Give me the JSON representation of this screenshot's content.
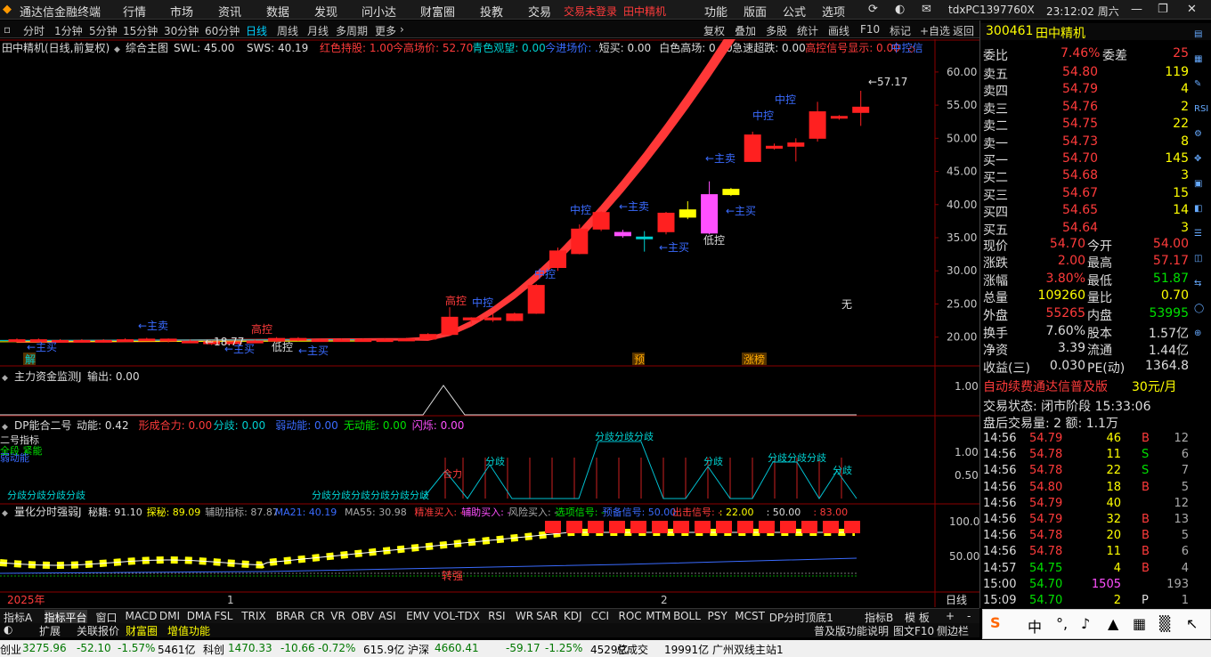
{
  "window": {
    "app_title": "通达信金融终端",
    "menu": [
      "行情",
      "市场",
      "资讯",
      "数据",
      "发现",
      "问小达",
      "财富圈",
      "投教",
      "交易"
    ],
    "trade_status": "交易未登录",
    "stock_name_top": "田中精机",
    "menu_right": [
      "功能",
      "版面",
      "公式",
      "选项"
    ],
    "host": "tdxPC1397760X",
    "clock": "23:12:02 周六"
  },
  "period_bar": {
    "items": [
      "分时",
      "1分钟",
      "5分钟",
      "15分钟",
      "30分钟",
      "60分钟",
      "日线",
      "周线",
      "月线",
      "多周期",
      "更多"
    ],
    "active": "日线",
    "right_buttons": [
      "复权",
      "叠加",
      "多股",
      "统计",
      "画线",
      "F10",
      "标记",
      "+自选",
      "返回"
    ]
  },
  "main_chart": {
    "header_prefix": "田中精机(日线,前复权)",
    "indicator_name": "综合主图",
    "indicators": [
      {
        "text": "SWL: 45.00",
        "color": "#dddddd"
      },
      {
        "text": "SWS: 40.19",
        "color": "#dddddd"
      },
      {
        "text": "红色持股: 1.00",
        "color": "#ff3b3b"
      },
      {
        "text": "今高场价: 52.70",
        "color": "#ff3b3b"
      },
      {
        "text": "青色观望: 0.00",
        "color": "#00d0d0"
      },
      {
        "text": "今进场价: .",
        "color": "#3a6bff"
      },
      {
        "text": "短买: 0.00",
        "color": "#dddddd"
      },
      {
        "text": "白色高场: 0.00",
        "color": "#dddddd"
      },
      {
        "text": "急速超跌: 0.00",
        "color": "#dddddd"
      },
      {
        "text": "高控信号显示: 0.00",
        "color": "#ff3b3b"
      },
      {
        "text": "中控信",
        "color": "#3a6bff"
      }
    ],
    "y_ticks": [
      "60.00",
      "55.00",
      "50.00",
      "45.00",
      "40.00",
      "35.00",
      "30.00",
      "25.00",
      "20.00"
    ],
    "price_high_label": "57.17",
    "price_low_label": "18.77",
    "none_label": "无",
    "bottom_tags": [
      "解",
      "预",
      "涨榜"
    ],
    "annotations": [
      "←主买",
      "←主卖",
      "高控",
      "低控",
      "中控",
      "←主卖",
      "←主买",
      "低控"
    ]
  },
  "chart_data": {
    "type": "candlestick",
    "ylim": [
      17,
      62
    ],
    "candles": [
      {
        "o": 19.6,
        "c": 19.5,
        "h": 19.8,
        "l": 19.3
      },
      {
        "o": 19.5,
        "c": 19.6,
        "h": 19.8,
        "l": 19.3
      },
      {
        "o": 19.5,
        "c": 19.4,
        "h": 19.7,
        "l": 19.2
      },
      {
        "o": 19.4,
        "c": 19.5,
        "h": 19.7,
        "l": 19.2
      },
      {
        "o": 19.5,
        "c": 19.4,
        "h": 19.7,
        "l": 19.2
      },
      {
        "o": 19.4,
        "c": 19.6,
        "h": 19.8,
        "l": 19.3
      },
      {
        "o": 19.6,
        "c": 19.7,
        "h": 19.9,
        "l": 19.4
      },
      {
        "o": 19.7,
        "c": 19.4,
        "h": 19.8,
        "l": 19.2
      },
      {
        "o": 19.4,
        "c": 19.3,
        "h": 19.6,
        "l": 19.1
      },
      {
        "o": 19.3,
        "c": 19.0,
        "h": 19.5,
        "l": 18.8
      },
      {
        "o": 19.0,
        "c": 19.3,
        "h": 19.4,
        "l": 18.77
      },
      {
        "o": 19.3,
        "c": 19.4,
        "h": 19.6,
        "l": 19.1
      },
      {
        "o": 19.4,
        "c": 19.8,
        "h": 20.0,
        "l": 19.2
      },
      {
        "o": 19.8,
        "c": 19.6,
        "h": 20.0,
        "l": 19.4
      },
      {
        "o": 19.6,
        "c": 19.5,
        "h": 19.8,
        "l": 19.3
      },
      {
        "o": 19.5,
        "c": 19.6,
        "h": 19.8,
        "l": 19.3
      },
      {
        "o": 19.6,
        "c": 19.5,
        "h": 19.8,
        "l": 19.3
      },
      {
        "o": 19.5,
        "c": 19.6,
        "h": 19.8,
        "l": 19.3
      },
      {
        "o": 19.6,
        "c": 19.7,
        "h": 19.9,
        "l": 19.4
      },
      {
        "o": 19.7,
        "c": 20.4,
        "h": 20.6,
        "l": 19.6
      },
      {
        "o": 20.4,
        "c": 23.0,
        "h": 24.5,
        "l": 20.3
      },
      {
        "o": 22.9,
        "c": 22.6,
        "h": 23.0,
        "l": 22.0
      },
      {
        "o": 22.6,
        "c": 22.9,
        "h": 23.5,
        "l": 22.3
      },
      {
        "o": 22.5,
        "c": 23.5,
        "h": 23.7,
        "l": 22.4
      },
      {
        "o": 23.6,
        "c": 27.8,
        "h": 28.0,
        "l": 23.5
      },
      {
        "o": 30.5,
        "c": 33.0,
        "h": 33.5,
        "l": 30.0
      },
      {
        "o": 32.6,
        "c": 36.3,
        "h": 37.0,
        "l": 32.5
      },
      {
        "o": 36.3,
        "c": 38.8,
        "h": 39.0,
        "l": 36.0
      },
      {
        "o": 35.8,
        "c": 35.3,
        "h": 36.2,
        "l": 35.0
      },
      {
        "o": 35.1,
        "c": 35.0,
        "h": 36.0,
        "l": 32.9
      },
      {
        "o": 35.9,
        "c": 38.7,
        "h": 38.9,
        "l": 35.5
      },
      {
        "o": 38.1,
        "c": 39.2,
        "h": 40.5,
        "l": 37.8
      },
      {
        "o": 35.7,
        "c": 41.5,
        "h": 43.5,
        "l": 35.5
      },
      {
        "o": 41.5,
        "c": 42.3,
        "h": 42.5,
        "l": 41.3
      },
      {
        "o": 46.5,
        "c": 50.5,
        "h": 51.0,
        "l": 46.5
      },
      {
        "o": 48.5,
        "c": 48.8,
        "h": 49.2,
        "l": 48.3
      },
      {
        "o": 48.8,
        "c": 49.3,
        "h": 50.0,
        "l": 46.5
      },
      {
        "o": 50.0,
        "c": 54.0,
        "h": 55.5,
        "l": 49.5
      },
      {
        "o": 53.1,
        "c": 53.3,
        "h": 53.5,
        "l": 52.8
      },
      {
        "o": 53.9,
        "c": 54.7,
        "h": 57.17,
        "l": 51.87
      }
    ]
  },
  "ind1": {
    "name": "主力资金监测J",
    "output": "输出: 0.00",
    "ticks": [
      "1.00"
    ]
  },
  "ind2": {
    "name": "DP能合二号",
    "items": [
      {
        "text": "动能: 0.42",
        "color": "#dddddd"
      },
      {
        "text": "形成合力: 0.00",
        "color": "#ff3b3b"
      },
      {
        "text": "分歧: 0.00",
        "color": "#00d0d0"
      },
      {
        "text": "弱动能: 0.00",
        "color": "#3a6bff"
      },
      {
        "text": "无动能: 0.00",
        "color": "#00e000"
      },
      {
        "text": "闪烁: 0.00",
        "color": "#ff50ff"
      }
    ],
    "ticks": [
      "1.00",
      "0.50"
    ],
    "left_labels": [
      "二号指标",
      "全段 紧能",
      "弱动能",
      "无动能"
    ],
    "peak_labels": [
      "分歧",
      "分歧",
      "分歧",
      "分歧",
      "分歧",
      "分歧",
      "合力",
      "分歧分歧分歧"
    ]
  },
  "ind3": {
    "name": "量化分时强弱J",
    "items": [
      {
        "text": "秘籍: 91.10",
        "color": "#dddddd"
      },
      {
        "text": "探秘: 89.09",
        "color": "#ffff00"
      },
      {
        "text": "辅助指标: 87.87",
        "color": "#aaaaaa"
      },
      {
        "text": "MA21: 40.19",
        "color": "#3a6bff"
      },
      {
        "text": "MA55: 30.98",
        "color": "#aaaaaa"
      },
      {
        "text": "精准买入: -",
        "color": "#ff3b3b"
      },
      {
        "text": "辅助买入: -",
        "color": "#ff50ff"
      },
      {
        "text": "风险买入: -",
        "color": "#aaaaaa"
      },
      {
        "text": "选项信号: -",
        "color": "#00e000"
      },
      {
        "text": "预备信号: 50.00",
        "color": "#3a6bff"
      },
      {
        "text": "出击信号: -",
        "color": "#ff3b3b"
      },
      {
        "text": ": 22.00",
        "color": "#ffff00"
      },
      {
        "text": ": 50.00",
        "color": "#dddddd"
      },
      {
        "text": ": 83.00",
        "color": "#ff3b3b"
      }
    ],
    "ticks": [
      "100.0",
      "50.00"
    ],
    "label_mid": "转强"
  },
  "x_axis": {
    "labels": [
      "2025年",
      "1",
      "2"
    ],
    "period": "日线"
  },
  "quote": {
    "code": "300461",
    "name": "田中精机",
    "weibi_label": "委比",
    "weibi": "7.46%",
    "weicha_label": "委差",
    "weicha": "25",
    "asks": [
      {
        "label": "卖五",
        "price": "54.80",
        "vol": "119"
      },
      {
        "label": "卖四",
        "price": "54.79",
        "vol": "4"
      },
      {
        "label": "卖三",
        "price": "54.76",
        "vol": "2"
      },
      {
        "label": "卖二",
        "price": "54.75",
        "vol": "22"
      },
      {
        "label": "卖一",
        "price": "54.73",
        "vol": "8"
      }
    ],
    "bids": [
      {
        "label": "买一",
        "price": "54.70",
        "vol": "145"
      },
      {
        "label": "买二",
        "price": "54.68",
        "vol": "3"
      },
      {
        "label": "买三",
        "price": "54.67",
        "vol": "15"
      },
      {
        "label": "买四",
        "price": "54.65",
        "vol": "14"
      },
      {
        "label": "买五",
        "price": "54.64",
        "vol": "3"
      }
    ],
    "stats": [
      {
        "l1": "现价",
        "v1": "54.70",
        "c1": "#ff3b3b",
        "l2": "今开",
        "v2": "54.00",
        "c2": "#ff3b3b"
      },
      {
        "l1": "涨跌",
        "v1": "2.00",
        "c1": "#ff3b3b",
        "l2": "最高",
        "v2": "57.17",
        "c2": "#ff3b3b"
      },
      {
        "l1": "涨幅",
        "v1": "3.80%",
        "c1": "#ff3b3b",
        "l2": "最低",
        "v2": "51.87",
        "c2": "#00e000"
      },
      {
        "l1": "总量",
        "v1": "109260",
        "c1": "#ffff00",
        "l2": "量比",
        "v2": "0.70",
        "c2": "#ffff00"
      },
      {
        "l1": "外盘",
        "v1": "55265",
        "c1": "#ff3b3b",
        "l2": "内盘",
        "v2": "53995",
        "c2": "#00e000"
      }
    ],
    "stats2": [
      {
        "l1": "换手",
        "v1": "7.60%",
        "l2": "股本",
        "v2": "1.57亿"
      },
      {
        "l1": "净资",
        "v1": "3.39",
        "l2": "流通",
        "v2": "1.44亿"
      },
      {
        "l1": "收益(三)",
        "v1": "0.030",
        "l2": "PE(动)",
        "v2": "1364.8"
      }
    ],
    "ad_text": "自动续费通达信普及版",
    "ad_price": "30元/月",
    "trade_status": "交易状态: 闭市阶段 15:33:06",
    "after_hours": "盘后交易量: 2  额: 1.1万",
    "ticks": [
      {
        "t": "14:56",
        "p": "54.79",
        "v": "46",
        "bs": "B",
        "n": "12"
      },
      {
        "t": "14:56",
        "p": "54.78",
        "v": "11",
        "bs": "S",
        "n": "6"
      },
      {
        "t": "14:56",
        "p": "54.78",
        "v": "22",
        "bs": "S",
        "n": "7"
      },
      {
        "t": "14:56",
        "p": "54.80",
        "v": "18",
        "bs": "B",
        "n": "5"
      },
      {
        "t": "14:56",
        "p": "54.79",
        "v": "40",
        "bs": "",
        "n": "12"
      },
      {
        "t": "14:56",
        "p": "54.79",
        "v": "32",
        "bs": "B",
        "n": "13"
      },
      {
        "t": "14:56",
        "p": "54.78",
        "v": "20",
        "bs": "B",
        "n": "5"
      },
      {
        "t": "14:56",
        "p": "54.78",
        "v": "11",
        "bs": "B",
        "n": "6"
      },
      {
        "t": "14:57",
        "p": "54.75",
        "v": "4",
        "bs": "B",
        "n": "4"
      },
      {
        "t": "15:00",
        "p": "54.70",
        "v": "1505",
        "bs": "",
        "n": "193"
      },
      {
        "t": "15:09",
        "p": "54.70",
        "v": "2",
        "bs": "P",
        "n": "1"
      }
    ]
  },
  "tabs": [
    "指标A",
    "指标平台",
    "窗口",
    "MACD",
    "DMI",
    "DMA",
    "FSL",
    "TRIX",
    "BRAR",
    "CR",
    "VR",
    "OBV",
    "ASI",
    "EMV",
    "VOL-TDX",
    "RSI",
    "WR",
    "SAR",
    "KDJ",
    "CCI",
    "ROC",
    "MTM",
    "BOLL",
    "PSY",
    "MCST",
    "DP分时顶底1"
  ],
  "tabs_right": [
    "指标B",
    "模 板",
    "+",
    "-"
  ],
  "tabs2": [
    "扩展",
    "关联报价",
    "财富圈",
    "增值功能"
  ],
  "tabs2_right": [
    "普及版功能说明",
    "图文F10",
    "侧边栏"
  ],
  "statusbar": [
    {
      "text": "创业",
      "color": "#000"
    },
    {
      "text": "3275.96",
      "color": "#007700"
    },
    {
      "text": "-52.10",
      "color": "#007700"
    },
    {
      "text": "-1.57%",
      "color": "#007700"
    },
    {
      "text": "5461亿",
      "color": "#000"
    },
    {
      "text": "科创",
      "color": "#000"
    },
    {
      "text": "1470.33",
      "color": "#007700"
    },
    {
      "text": "-10.66",
      "color": "#007700"
    },
    {
      "text": "-0.72%",
      "color": "#007700"
    },
    {
      "text": "615.9亿",
      "color": "#000"
    },
    {
      "text": "沪深",
      "color": "#000"
    },
    {
      "text": "4660.41",
      "color": "#007700"
    },
    {
      "text": "-59.17",
      "color": "#007700"
    },
    {
      "text": "-1.25%",
      "color": "#007700"
    },
    {
      "text": "4529亿",
      "color": "#000"
    },
    {
      "text": "总成交",
      "color": "#000"
    },
    {
      "text": "19991亿",
      "color": "#000"
    },
    {
      "text": "广州双线主站1",
      "color": "#000"
    }
  ],
  "ime": {
    "chars": [
      "中",
      "°,",
      "🎤"
    ]
  }
}
